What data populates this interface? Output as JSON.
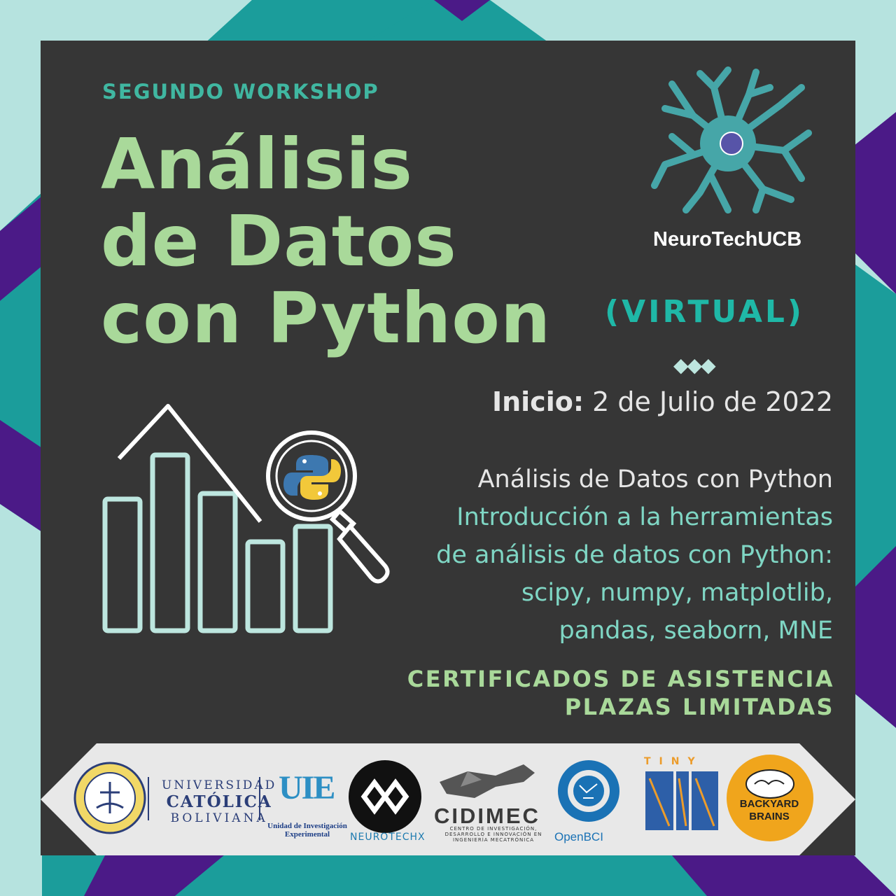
{
  "header": {
    "kicker": "SEGUNDO WORKSHOP",
    "title_lines": [
      "Análisis",
      "de Datos",
      "con Python"
    ],
    "mode": "(VIRTUAL)"
  },
  "brand": {
    "name": "NeuroTechUCB",
    "icon": "neuron-icon"
  },
  "separator": "◆◆◆",
  "start": {
    "label": "Inicio:",
    "date": "2 de Julio de 2022"
  },
  "description": {
    "title": "Análisis de Datos con Python",
    "lines": [
      "Introducción a la herramientas",
      "de análisis de datos con Python:",
      "scipy, numpy, matplotlib,",
      "pandas, seaborn, MNE"
    ]
  },
  "notes": [
    "CERTIFICADOS DE ASISTENCIA",
    "PLAZAS LIMITADAS"
  ],
  "graphic": {
    "icon": "bar-chart-magnifier-python-icon"
  },
  "sponsors": {
    "ucb": {
      "lines": [
        "UNIVERSIDAD",
        "CATÓLICA",
        "BOLIVIANA"
      ]
    },
    "uie": {
      "mark": "UIE",
      "caption": "Unidad de Investigación Experimental"
    },
    "neurotechx": {
      "caption": "NEUROTECHX"
    },
    "cidimec": {
      "mark": "CIDIMEC",
      "caption": "CENTRO DE INVESTIGACIÓN, DESARROLLO E INNOVACIÓN EN INGENIERÍA MECATRÓNICA"
    },
    "openbci": {
      "caption": "OpenBCI"
    },
    "tinyml": {
      "top": "TINY"
    },
    "backyard": {
      "lines": [
        "BACKYARD",
        "BRAINS"
      ]
    }
  },
  "colors": {
    "background": "#363636",
    "title": "#a9d99a",
    "accent_teal": "#1fb8a7",
    "frame_teal": "#1b9d9b",
    "frame_light": "#b6e3df",
    "frame_purple": "#4b1a87"
  }
}
